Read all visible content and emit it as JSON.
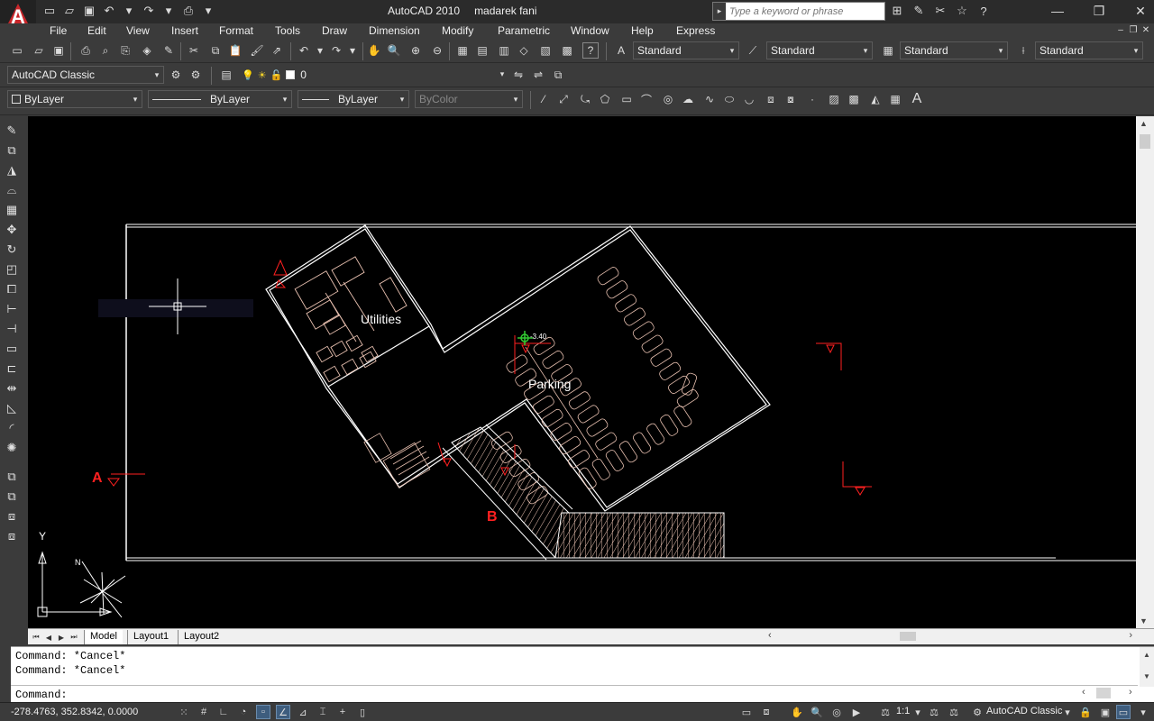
{
  "titlebar": {
    "app_name": "AutoCAD 2010",
    "document_name": "madarek fani",
    "search_placeholder": "Type a keyword or phrase",
    "window_min": "—",
    "window_max": "❐",
    "window_close": "✕"
  },
  "menu": [
    "File",
    "Edit",
    "View",
    "Insert",
    "Format",
    "Tools",
    "Draw",
    "Dimension",
    "Modify",
    "Parametric",
    "Window",
    "Help",
    "Express"
  ],
  "styles_toolbar": {
    "text_style": "Standard",
    "dim_style": "Standard",
    "table_style": "Standard",
    "multileader_style": "Standard"
  },
  "workspace": "AutoCAD Classic",
  "layer": "0",
  "properties": {
    "color": "ByLayer",
    "linetype": "ByLayer",
    "lineweight": "ByLayer",
    "plotstyle": "ByColor"
  },
  "drawing": {
    "room_utilities": "Utilities",
    "room_parking": "Parking",
    "elevation": "-3.40",
    "section_a": "A",
    "section_b": "B",
    "ucs_y": "Y",
    "north": "N",
    "accent_red": "#ff2020",
    "line_color": "#ffffff",
    "hatch_color": "#e8c0b0"
  },
  "layout_tabs": [
    "Model",
    "Layout1",
    "Layout2"
  ],
  "command": {
    "history": [
      "Command: *Cancel*",
      "Command: *Cancel*"
    ],
    "prompt": "Command:"
  },
  "status": {
    "coordinates": "-278.4763, 352.8342, 0.0000",
    "annotation_scale": "1:1",
    "workspace": "AutoCAD Classic"
  }
}
